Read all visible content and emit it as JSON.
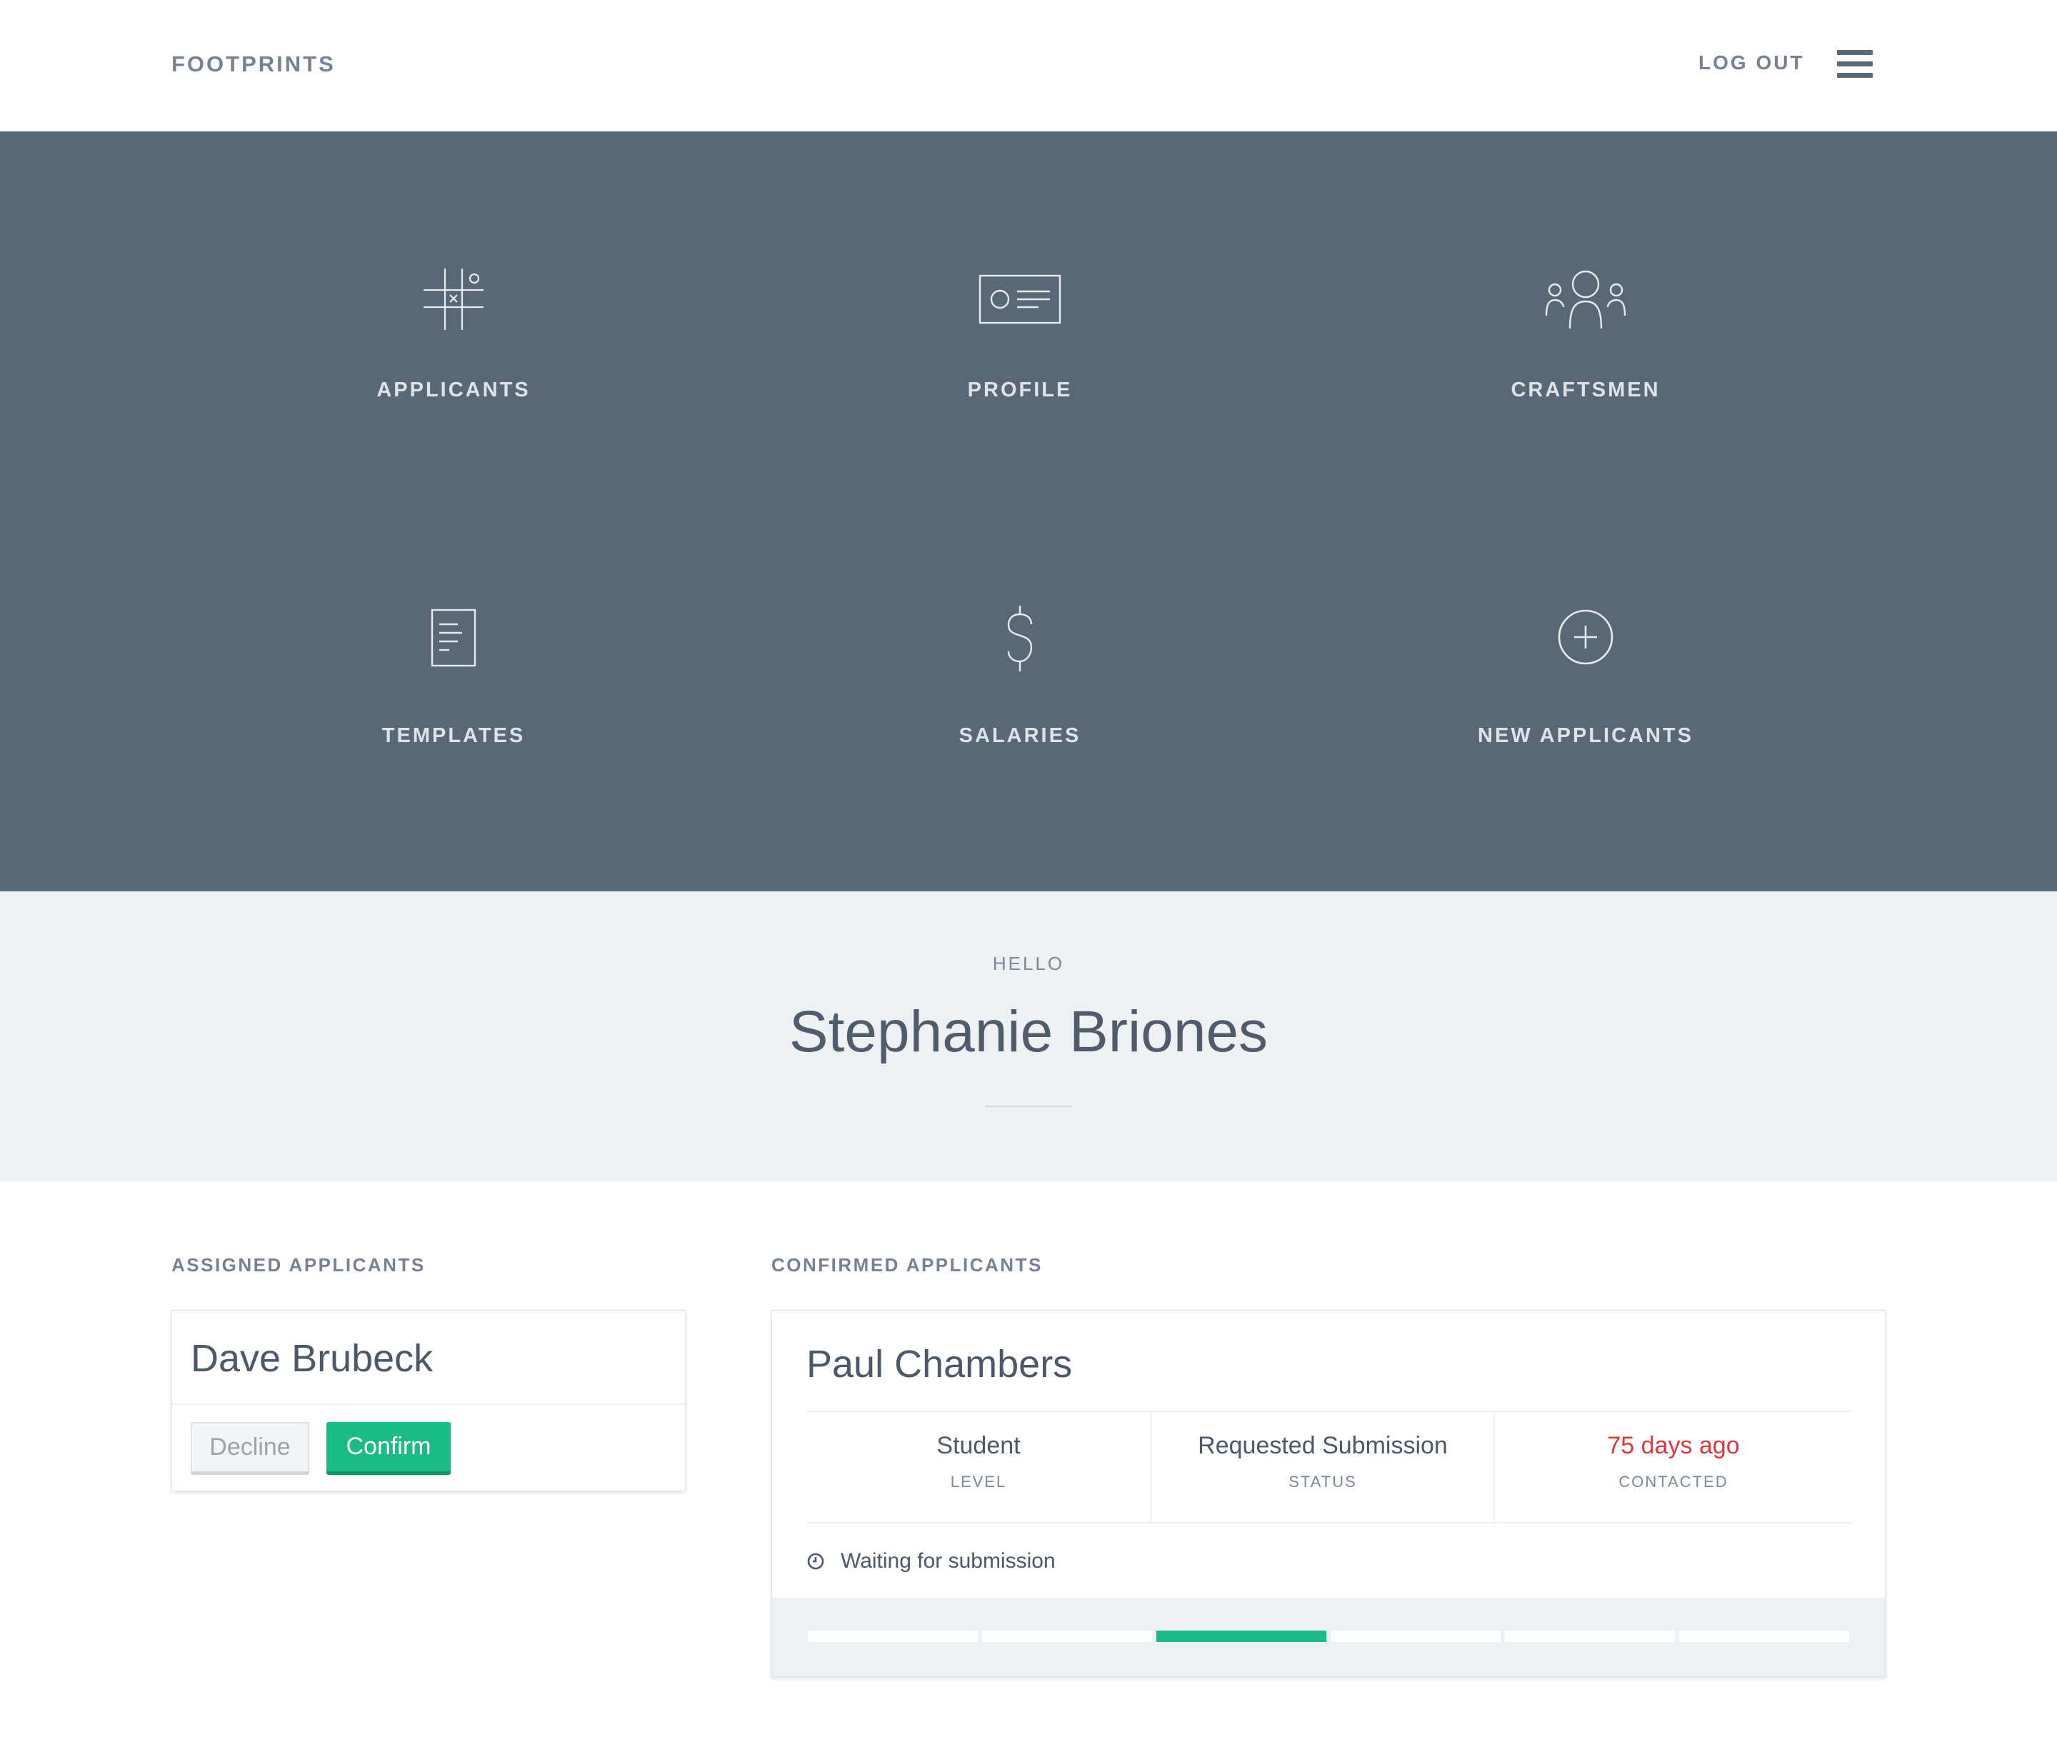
{
  "header": {
    "logo": "FOOTPRINTS",
    "logout_label": "LOG OUT",
    "menu_icon": "hamburger-icon"
  },
  "nav": {
    "items": [
      {
        "label": "APPLICANTS",
        "icon": "tic-tac-toe-icon"
      },
      {
        "label": "PROFILE",
        "icon": "id-card-icon"
      },
      {
        "label": "CRAFTSMEN",
        "icon": "people-group-icon"
      },
      {
        "label": "TEMPLATES",
        "icon": "document-icon"
      },
      {
        "label": "SALARIES",
        "icon": "dollar-icon"
      },
      {
        "label": "NEW APPLICANTS",
        "icon": "plus-circle-icon"
      }
    ]
  },
  "greeting": {
    "hello": "HELLO",
    "name": "Stephanie Briones"
  },
  "assigned": {
    "title": "ASSIGNED APPLICANTS",
    "applicant_name": "Dave Brubeck",
    "decline_label": "Decline",
    "confirm_label": "Confirm"
  },
  "confirmed": {
    "title": "CONFIRMED APPLICANTS",
    "applicant_name": "Paul Chambers",
    "stats": [
      {
        "value": "Student",
        "caption": "LEVEL"
      },
      {
        "value": "Requested Submission",
        "caption": "STATUS"
      },
      {
        "value": "75 days ago",
        "caption": "CONTACTED"
      }
    ],
    "waiting_text": "Waiting for submission",
    "progress": {
      "total_steps": 6,
      "active_step": 3
    }
  },
  "colors": {
    "nav_bg": "#586877",
    "greeting_bg": "#eef1f3",
    "accent_green": "#1abc86",
    "alert_red": "#e0373d"
  }
}
